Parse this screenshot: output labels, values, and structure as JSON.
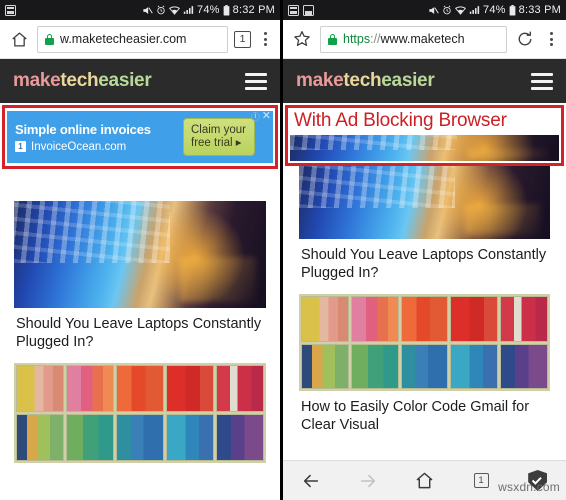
{
  "left_phone": {
    "status_bar": {
      "notification_icons": [
        "notification-icon"
      ],
      "mute_icon": "mute-icon",
      "alarm_icon": "alarm-icon",
      "wifi_icon": "wifi-icon",
      "signal_icon": "signal-icon",
      "battery_percent": "74%",
      "battery_icon": "battery-icon",
      "time": "8:32 PM"
    },
    "url_bar": {
      "home_icon": "home-icon",
      "lock_icon": "lock-icon",
      "url": "w.maketecheasier.com",
      "tab_count": "1",
      "menu_icon": "overflow-menu-icon"
    },
    "site_header": {
      "logo_part1": "make",
      "logo_part2": "tech",
      "logo_part3": "easier",
      "menu_icon": "hamburger-icon"
    },
    "ad": {
      "title": "Simple online invoices",
      "badge": "1",
      "domain": "InvoiceOcean.com",
      "cta_line1": "Claim your",
      "cta_line2": "free trial ▸",
      "info_icon": "ad-info-icon",
      "close_icon": "ad-close-icon"
    },
    "articles": [
      {
        "image": "laptop-keyboard-photo",
        "title": "Should You Leave Laptops Constantly Plugged In?"
      },
      {
        "image": "color-coded-bookshelf-photo",
        "title": ""
      }
    ]
  },
  "right_phone": {
    "status_bar": {
      "notification_icons": [
        "notification-icon",
        "notification-icon"
      ],
      "mute_icon": "mute-icon",
      "alarm_icon": "alarm-icon",
      "wifi_icon": "wifi-icon",
      "signal_icon": "signal-icon",
      "battery_percent": "74%",
      "battery_icon": "battery-icon",
      "time": "8:33 PM"
    },
    "url_bar": {
      "star_icon": "bookmark-star-icon",
      "lock_icon": "lock-icon",
      "url_scheme": "https",
      "url_sep": "://",
      "url_host": "www.maketech",
      "reload_icon": "reload-icon",
      "menu_icon": "overflow-menu-icon"
    },
    "site_header": {
      "logo_part1": "make",
      "logo_part2": "tech",
      "logo_part3": "easier",
      "menu_icon": "hamburger-icon"
    },
    "caption": "With Ad Blocking Browser",
    "articles": [
      {
        "image": "laptop-keyboard-photo",
        "title": "Should You Leave Laptops Constantly Plugged In?"
      },
      {
        "image": "color-coded-bookshelf-photo",
        "title": "How to Easily Color Code Gmail for Clear Visual"
      }
    ],
    "bottom_nav": {
      "back_icon": "back-arrow-icon",
      "forward_icon": "forward-arrow-icon",
      "home_icon": "home-icon",
      "tab_count": "1",
      "shield_icon": "shield-check-icon"
    },
    "watermark": "wsxdn.com"
  },
  "colors": {
    "highlight_red": "#d3222a",
    "caption_red": "#cc2026",
    "header_dark": "#2b2b2b",
    "ad_blue": "#3f9fe8",
    "ad_cta_green": "#c3d76c",
    "lock_green": "#12a04a"
  }
}
